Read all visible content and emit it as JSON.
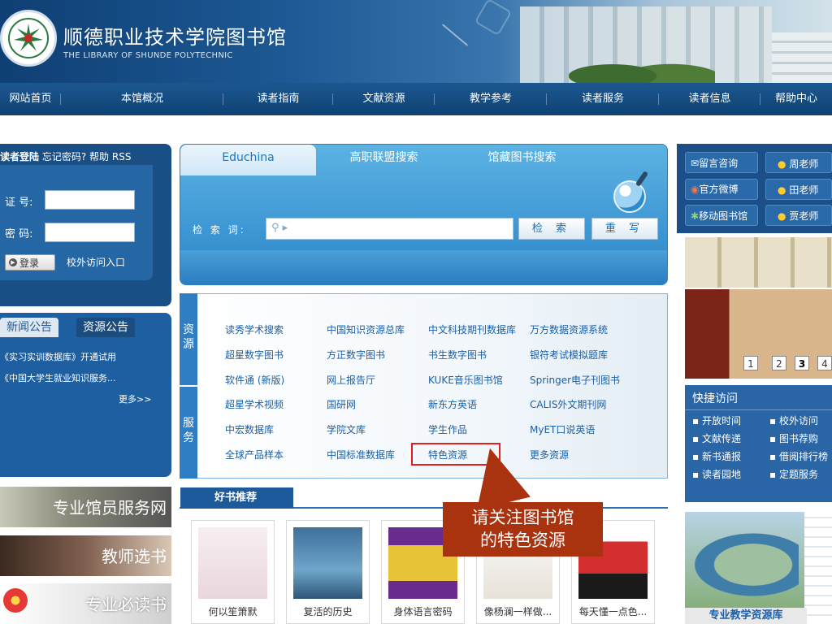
{
  "header": {
    "title": "顺德职业技术学院图书馆",
    "subtitle": "THE LIBRARY OF SHUNDE POLYTECHNIC"
  },
  "nav": [
    "网站首页",
    "本馆概况",
    "读者指南",
    "文献资源",
    "教学参考",
    "读者服务",
    "读者信息",
    "帮助中心"
  ],
  "login": {
    "heading": "读者登陆",
    "forgot": "忘记密码?",
    "help": "帮助",
    "rss": "RSS",
    "id_label": "证 号:",
    "pwd_label": "密 码:",
    "login_button": "登录",
    "offcampus": "校外访问入口"
  },
  "news": {
    "tabs": [
      "新闻公告",
      "资源公告"
    ],
    "items": [
      "《实习实训数据库》开通试用",
      "《中国大学生就业知识服务..."
    ],
    "more": "更多>>"
  },
  "promos": [
    "专业馆员服务网",
    "教师选书",
    "专业必读书"
  ],
  "search": {
    "tabs": [
      "Educhina",
      "高职联盟搜索",
      "馆藏图书搜索"
    ],
    "label": "检 索 词:",
    "search_button": "检 索",
    "reset_button": "重 写"
  },
  "resources": {
    "side_labels": [
      "资源",
      "服务"
    ],
    "rows": [
      [
        "读秀学术搜索",
        "中国知识资源总库",
        "中文科技期刊数据库",
        "万方数据资源系统"
      ],
      [
        "超星数字图书",
        "方正数字图书",
        "书生数字图书",
        "银符考试模拟题库"
      ],
      [
        "软件通 (新版)",
        "网上报告厅",
        "KUKE音乐图书馆",
        "Springer电子刊图书"
      ],
      [
        "超星学术视频",
        "国研网",
        "新东方英语",
        "CALIS外文期刊网"
      ],
      [
        "中宏数据库",
        "学院文库",
        "学生作品",
        "MyET口说英语"
      ],
      [
        "全球产品样本",
        "中国标准数据库",
        "特色资源",
        "更多资源"
      ]
    ]
  },
  "callout": {
    "line1": "请关注图书馆",
    "line2": "的特色资源"
  },
  "books": {
    "section_title": "好书推荐",
    "items": [
      "何以笙箫默",
      "复活的历史",
      "身体语言密码",
      "像杨澜一样做...",
      "每天懂一点色..."
    ]
  },
  "right": {
    "links": [
      "留言咨询",
      "官方微博",
      "移动图书馆"
    ],
    "teachers": [
      "周老师",
      "田老师",
      "贾老师"
    ],
    "slider_pages": [
      "1",
      "2",
      "3",
      "4"
    ],
    "quick_title": "快捷访问",
    "quick_links": [
      [
        "开放时间",
        "校外访问"
      ],
      [
        "文献传递",
        "图书荐购"
      ],
      [
        "新书通报",
        "借阅排行榜"
      ],
      [
        "读者园地",
        "定题服务"
      ]
    ],
    "course_caption": "专业教学资源库"
  },
  "colors": {
    "header_blue": "#1d5994",
    "nav_blue": "#0f4273",
    "link_blue": "#1a5fa8",
    "highlight_red": "#e01e1e",
    "callout_brown": "#a9320f"
  }
}
